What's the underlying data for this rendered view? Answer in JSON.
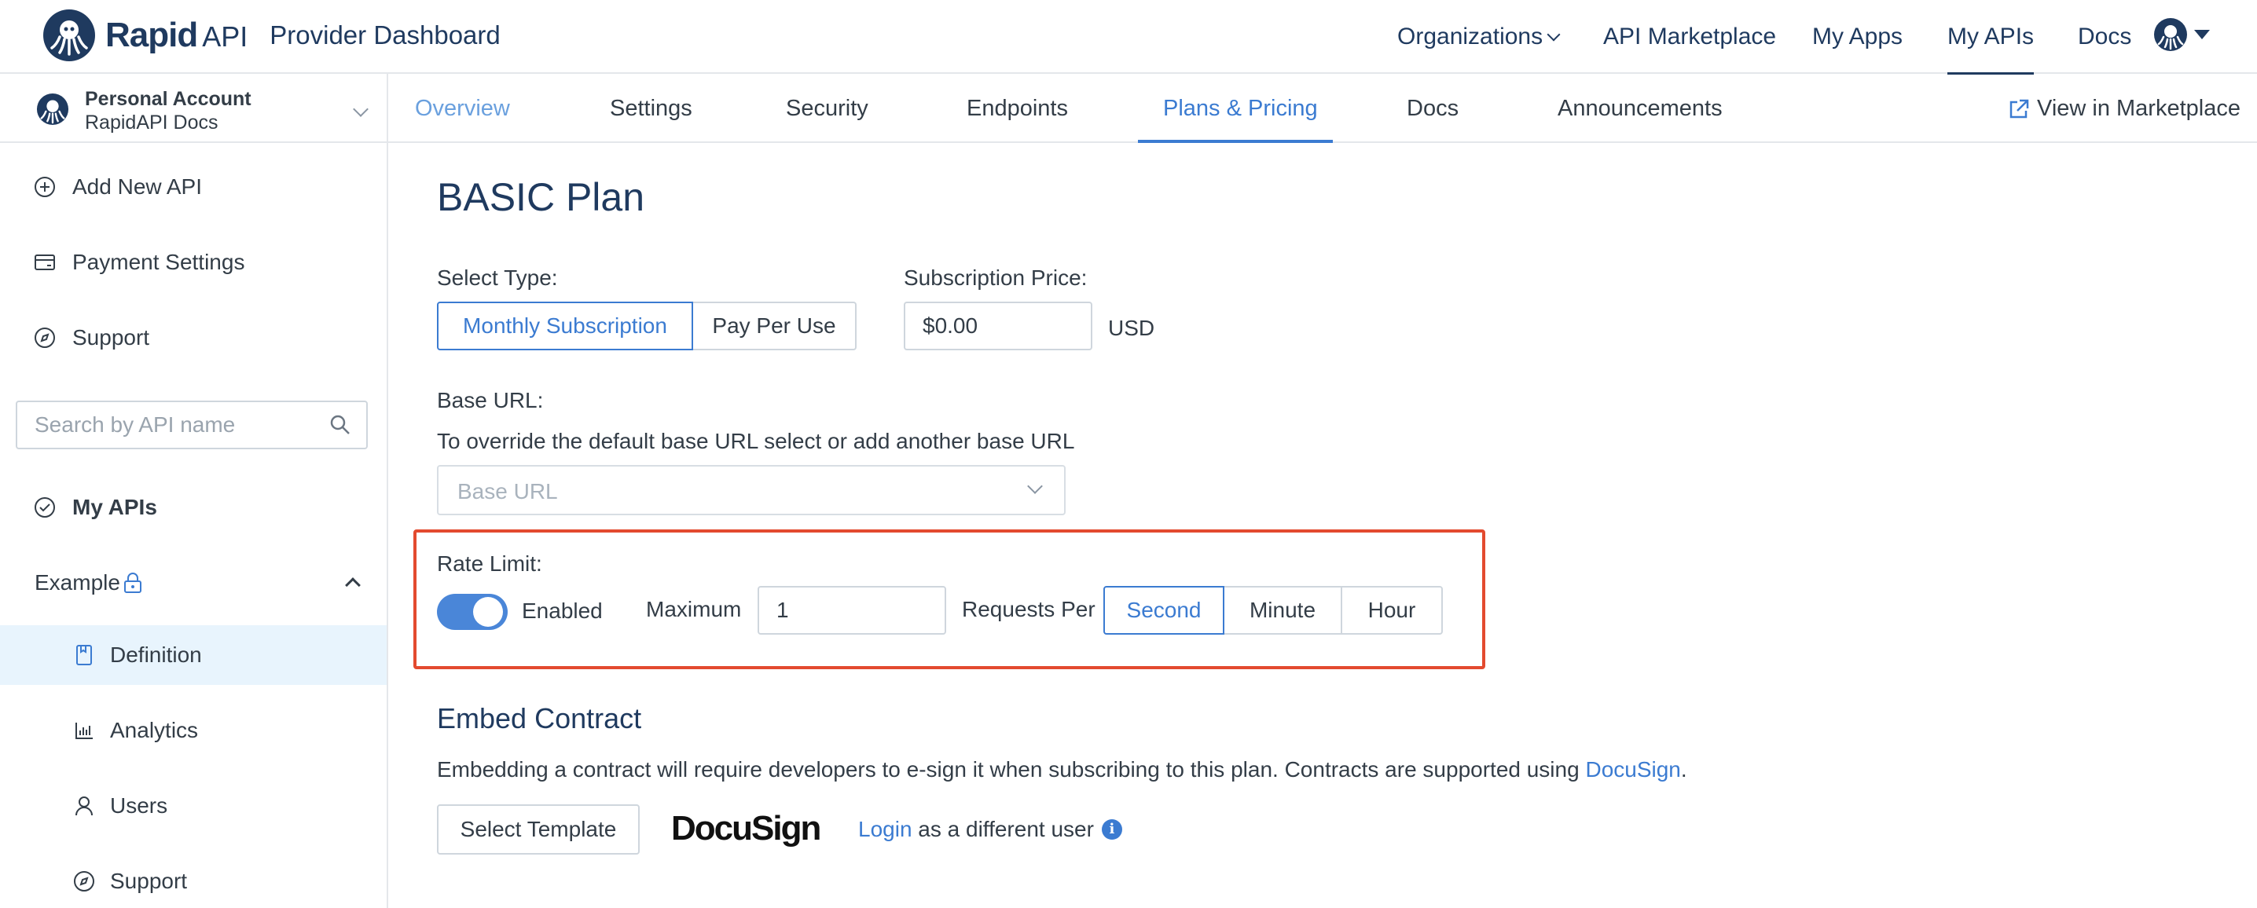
{
  "header": {
    "brand": "Rapid",
    "brand_suffix": "API",
    "product": "Provider Dashboard",
    "nav": [
      "Organizations",
      "API Marketplace",
      "My Apps",
      "My APIs",
      "Docs"
    ],
    "active_nav": "My APIs"
  },
  "sidebar": {
    "account_name": "Personal Account",
    "account_sub": "RapidAPI Docs",
    "items_top": [
      {
        "label": "Add New API",
        "icon": "plus-circle-icon"
      },
      {
        "label": "Payment Settings",
        "icon": "credit-card-icon"
      },
      {
        "label": "Support",
        "icon": "compass-icon"
      }
    ],
    "search_placeholder": "Search by API name",
    "my_apis": "My APIs",
    "api_name": "Example",
    "sub_items": [
      {
        "label": "Definition",
        "icon": "document-icon",
        "selected": true
      },
      {
        "label": "Analytics",
        "icon": "bar-chart-icon"
      },
      {
        "label": "Users",
        "icon": "user-icon"
      },
      {
        "label": "Support",
        "icon": "compass-icon"
      }
    ]
  },
  "tabs": {
    "items": [
      "Overview",
      "Settings",
      "Security",
      "Endpoints",
      "Plans & Pricing",
      "Docs",
      "Announcements"
    ],
    "active": "Plans & Pricing",
    "view_in_marketplace": "View in Marketplace"
  },
  "plan": {
    "title": "BASIC Plan",
    "select_type_label": "Select Type:",
    "types": [
      "Monthly Subscription",
      "Pay Per Use"
    ],
    "selected_type": "Monthly Subscription",
    "price_label": "Subscription Price:",
    "price_value": "$0.00",
    "currency": "USD",
    "base_url_label": "Base URL:",
    "base_url_help": "To override the default base URL select or add another base URL",
    "base_url_placeholder": "Base URL",
    "rate_limit_label": "Rate Limit:",
    "rate_limit_enabled": true,
    "enabled_label": "Enabled",
    "maximum_label": "Maximum",
    "maximum_value": "1",
    "requests_per_label": "Requests Per",
    "periods": [
      "Second",
      "Minute",
      "Hour"
    ],
    "selected_period": "Second"
  },
  "embed": {
    "title": "Embed Contract",
    "description": "Embedding a contract will require developers to e-sign it when subscribing to this plan. Contracts are supported using",
    "docusign_link": "DocuSign",
    "period": ".",
    "select_template": "Select Template",
    "docusign_logo": "DocuSign",
    "login_link": "Login",
    "login_suffix": "as a different user",
    "info_icon": "i"
  },
  "colors": {
    "accent": "#3b7bd1",
    "navy": "#1f3a5f",
    "highlight": "#e34a2f",
    "selected_bg": "#e8f4fd"
  }
}
